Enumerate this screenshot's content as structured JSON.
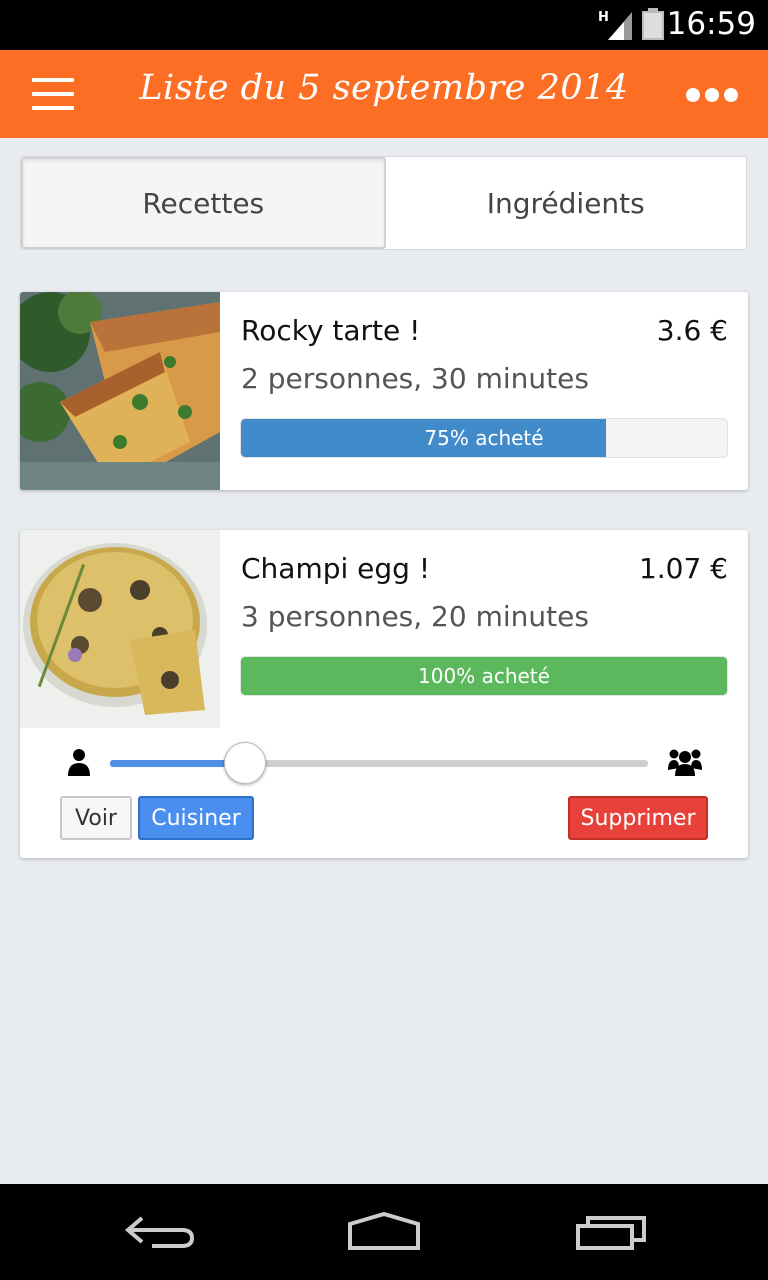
{
  "status_bar": {
    "network": "H",
    "time": "16:59"
  },
  "app_bar": {
    "title": "Liste du 5 septembre 2014",
    "menu_icon": "hamburger-icon",
    "more_icon": "more-dots-icon"
  },
  "tabs": [
    {
      "label": "Recettes",
      "active": true
    },
    {
      "label": "Ingrédients",
      "active": false
    }
  ],
  "recipes": [
    {
      "name": "Rocky tarte !",
      "price": "3.6 €",
      "meta": "2 personnes, 30 minutes",
      "progress_label": "75% acheté",
      "progress": 0.75,
      "color": "#428bca"
    },
    {
      "name": "Champi egg !",
      "price": "1.07 €",
      "meta": "3 personnes, 20 minutes",
      "progress_label": "100% acheté",
      "progress": 1.0,
      "color": "#5cb85c"
    }
  ],
  "servings_slider": {
    "value": 0.25,
    "min_icon": "person-icon",
    "max_icon": "group-icon"
  },
  "actions": {
    "view": "Voir",
    "cook": "Cuisiner",
    "delete": "Supprimer"
  },
  "colors": {
    "app_bar": "#fb6e24",
    "background": "#e8ebef",
    "delete": "#e8413a",
    "cook": "#4a8ff0"
  }
}
